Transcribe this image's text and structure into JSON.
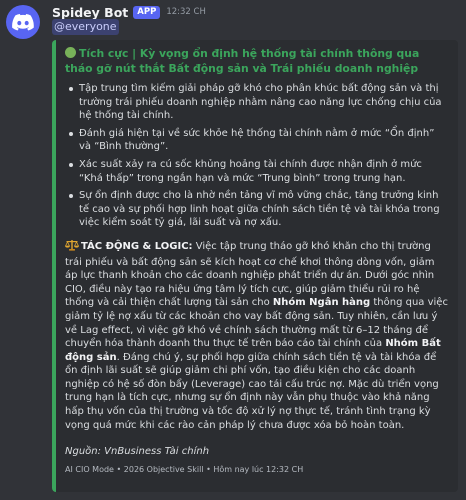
{
  "author": {
    "name": "Spidey Bot",
    "badge": "APP",
    "time": "12:32 CH"
  },
  "mention": "@everyone",
  "embed": {
    "accent_color": "#3ba55c",
    "title": "Tích cực | Kỳ vọng ổn định hệ thống tài chính thông qua tháo gỡ nút thắt Bất động sản và Trái phiếu doanh nghiệp",
    "bullets": [
      "Tập trung tìm kiếm giải pháp gỡ khó cho phân khúc bất động sản và thị trường trái phiếu doanh nghiệp nhằm nâng cao năng lực chống chịu của hệ thống tài chính.",
      "Đánh giá hiện tại về sức khỏe hệ thống tài chính nằm ở mức “Ổn định” và “Bình thường”.",
      "Xác suất xảy ra cú sốc khủng hoảng tài chính được nhận định ở mức “Khá thấp” trong ngắn hạn và mức “Trung bình” trong trung hạn.",
      "Sự ổn định được cho là nhờ nền tảng vĩ mô vững chắc, tăng trưởng kinh tế cao và sự phối hợp linh hoạt giữa chính sách tiền tệ và tài khóa trong việc kiểm soát tỷ giá, lãi suất và nợ xấu."
    ],
    "impact": {
      "heading": "TÁC ĐỘNG & LOGIC:",
      "p1": " Việc tập trung tháo gỡ khó khăn cho thị trường trái phiếu và bất động sản sẽ kích hoạt cơ chế khơi thông dòng vốn, giảm áp lực thanh khoản cho các doanh nghiệp phát triển dự án. Dưới góc nhìn CIO, điều này tạo ra hiệu ứng tâm lý tích cực, giúp giảm thiểu rủi ro hệ thống và cải thiện chất lượng tài sản cho ",
      "bank": "Nhóm Ngân hàng",
      "p2": " thông qua việc giảm tỷ lệ nợ xấu từ các khoản cho vay bất động sản. Tuy nhiên, cần lưu ý về Lag effect, vì việc gỡ khó về chính sách thường mất từ 6–12 tháng để chuyển hóa thành doanh thu thực tế trên báo cáo tài chính của ",
      "realestate": "Nhóm Bất động sản",
      "p3": ". Đáng chú ý, sự phối hợp giữa chính sách tiền tệ và tài khóa để ổn định lãi suất sẽ giúp giảm chi phí vốn, tạo điều kiện cho các doanh nghiệp có hệ số đòn bẩy (Leverage) cao tái cấu trúc nợ. Mặc dù triển vọng trung hạn là tích cực, nhưng sự ổn định này vẫn phụ thuộc vào khả năng hấp thụ vốn của thị trường và tốc độ xử lý nợ thực tế, tránh tình trạng kỳ vọng quá mức khi các rào cản pháp lý chưa được xóa bỏ hoàn toàn."
    },
    "source": "Nguồn: VnBusiness Tài chính",
    "footer": "AI CIO Mode • 2026 Objective Skill • Hôm nay lúc 12:32 CH"
  }
}
